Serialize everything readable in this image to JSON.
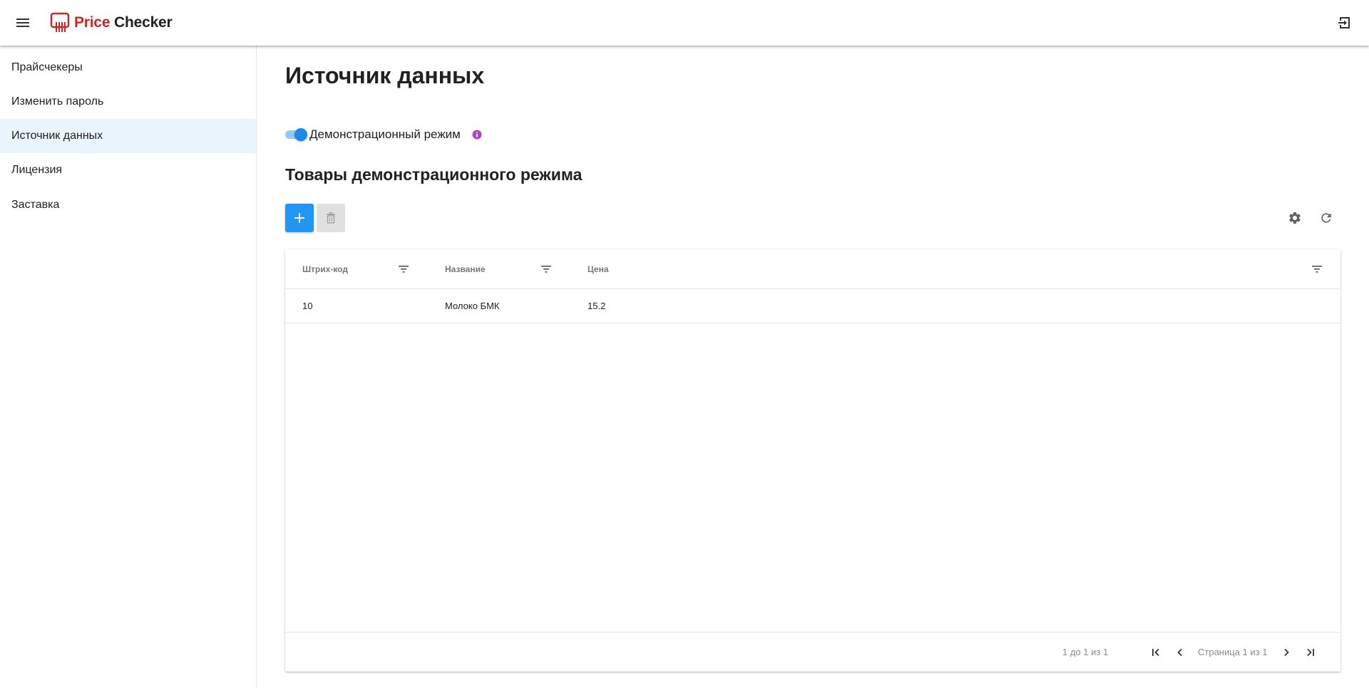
{
  "app": {
    "brand_part1": "Price",
    "brand_part2": "Checker",
    "menu_icon": "hamburger-menu-icon",
    "logout_icon": "logout-icon"
  },
  "sidebar": {
    "items": [
      {
        "label": "Прайсчекеры",
        "active": false
      },
      {
        "label": "Изменить пароль",
        "active": false
      },
      {
        "label": "Источник данных",
        "active": true
      },
      {
        "label": "Лицензия",
        "active": false
      },
      {
        "label": "Заставка",
        "active": false
      }
    ]
  },
  "page": {
    "title": "Источник данных",
    "demo_toggle": {
      "label": "Демонстрационный режим",
      "checked": true
    },
    "section_title": "Товары демонстрационного режима"
  },
  "grid": {
    "columns": [
      "Штрих-код",
      "Название",
      "Цена"
    ],
    "rows": [
      {
        "barcode": "10",
        "name": "Молоко БМК",
        "price": "15.2"
      }
    ],
    "footer": {
      "summary": "1 до 1 из 1",
      "page_label": "Страница 1 из 1"
    }
  },
  "colors": {
    "accent": "#2196f3",
    "brand_red": "#c62828",
    "active_nav_bg": "#eaf4fd",
    "info_purple": "#ab47bc"
  }
}
